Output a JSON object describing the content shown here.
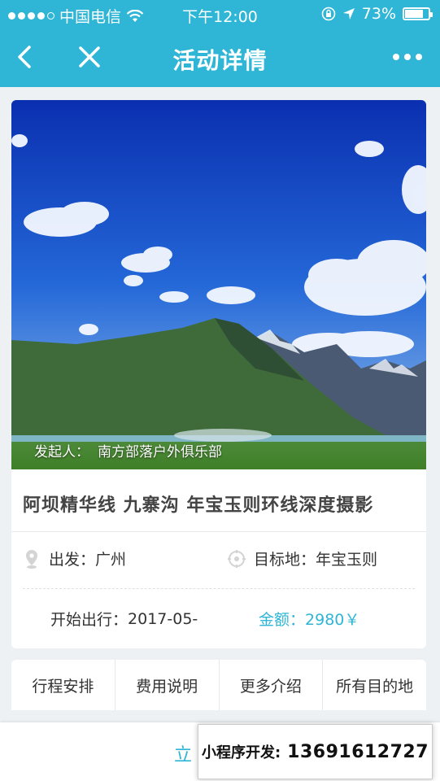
{
  "status_bar": {
    "carrier": "中国电信",
    "time": "下午12:00",
    "battery_text": "73%",
    "battery_level": 0.73
  },
  "nav": {
    "title": "活动详情"
  },
  "event": {
    "organizer_label": "发起人：",
    "organizer_name": "南方部落户外俱乐部",
    "title": "阿坝精华线 九寨沟 年宝玉则环线深度摄影",
    "departure_label": "出发：",
    "departure_value": "广州",
    "destination_label": "目标地：",
    "destination_value": "年宝玉则",
    "start_label": "开始出行：",
    "start_value": "2017-05-",
    "price_label": "金额：",
    "price_value": "2980￥"
  },
  "tabs": [
    {
      "label": "行程安排"
    },
    {
      "label": "费用说明"
    },
    {
      "label": "更多介绍"
    },
    {
      "label": "所有目的地"
    }
  ],
  "bottom": {
    "join_label": "立",
    "watermark_label": "小程序开发:",
    "watermark_phone": "13691612727"
  },
  "colors": {
    "brand": "#2fb6d6",
    "text": "#333333"
  }
}
